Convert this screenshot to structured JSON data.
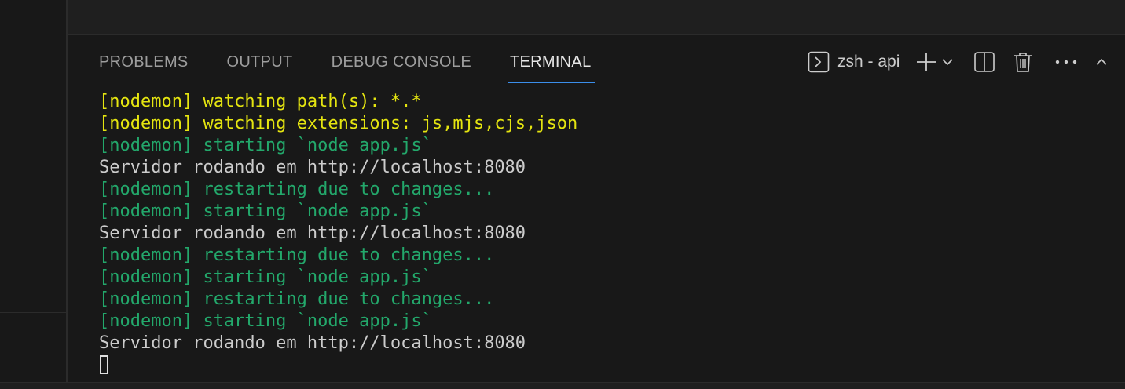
{
  "panel": {
    "tabs": [
      {
        "label": "PROBLEMS",
        "active": false
      },
      {
        "label": "OUTPUT",
        "active": false
      },
      {
        "label": "DEBUG CONSOLE",
        "active": false
      },
      {
        "label": "TERMINAL",
        "active": true
      }
    ],
    "terminal_name": "zsh - api",
    "icons": [
      "terminal-icon",
      "plus-icon",
      "chevron-down-icon",
      "split-icon",
      "trash-icon",
      "more-icon",
      "chevron-up-icon"
    ]
  },
  "terminal": {
    "lines": [
      {
        "text": "[nodemon] watching path(s): *.*",
        "color": "yellow"
      },
      {
        "text": "[nodemon] watching extensions: js,mjs,cjs,json",
        "color": "yellow"
      },
      {
        "text": "[nodemon] starting `node app.js`",
        "color": "green"
      },
      {
        "text": "Servidor rodando em http://localhost:8080",
        "color": "white"
      },
      {
        "text": "[nodemon] restarting due to changes...",
        "color": "green"
      },
      {
        "text": "[nodemon] starting `node app.js`",
        "color": "green"
      },
      {
        "text": "Servidor rodando em http://localhost:8080",
        "color": "white"
      },
      {
        "text": "[nodemon] restarting due to changes...",
        "color": "green"
      },
      {
        "text": "[nodemon] starting `node app.js`",
        "color": "green"
      },
      {
        "text": "[nodemon] restarting due to changes...",
        "color": "green"
      },
      {
        "text": "[nodemon] starting `node app.js`",
        "color": "green"
      },
      {
        "text": "Servidor rodando em http://localhost:8080",
        "color": "white"
      }
    ]
  },
  "colors": {
    "yellow": "#e5e510",
    "green": "#23a86b",
    "white": "#cccccc",
    "accent": "#3b8eea"
  }
}
